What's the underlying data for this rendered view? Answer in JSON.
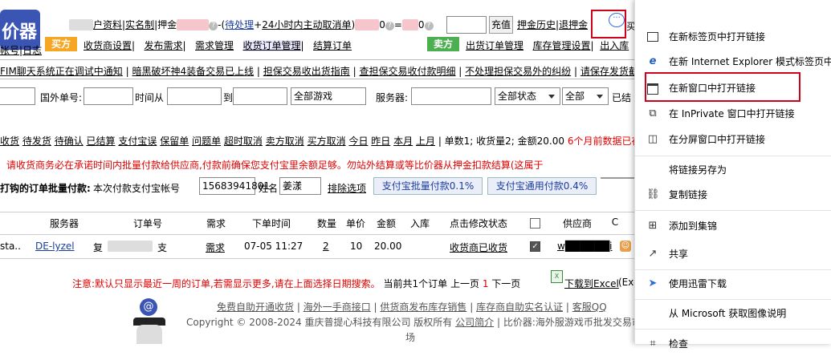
{
  "top": {
    "account_masked": "██████",
    "profile_link": "户资料",
    "realname_link": "实名制",
    "deposit_label": "押金",
    "deposit_value": "████",
    "pending_link": "待处理",
    "plus_text": "+",
    "cancel24_link": "24小时内主动取消单",
    "paren_close": ")",
    "zero1": "0",
    "eq": "=",
    "zero2": "0",
    "charge_button": "充值",
    "deposit_history": "押金历史",
    "withdraw_deposit": "退押金",
    "partial_text": "买"
  },
  "nav": {
    "logo_text": "价器",
    "buyer_tag": "买方",
    "buyer_links": [
      "收货商设置",
      "发布需求",
      "需求管理",
      "收货订单管理",
      "结算订单"
    ],
    "seller_tag": "卖方",
    "seller_links": [
      "出货订单管理",
      "库存管理设置",
      "出入库"
    ],
    "left_links": [
      "帐号",
      "日志"
    ]
  },
  "notice_bar": [
    "FIM聊天系统正在调试中通知",
    "暗黑破坏神4装备交易已上线",
    "担保交易收出货指南",
    "查担保交易收付款明细",
    "不处理担保交易外的纠纷",
    "请保存发货截"
  ],
  "filters": {
    "foreign_order_label": "国外单号:",
    "time_from_label": "时间从",
    "to_label": "到",
    "game_select": "全部游戏",
    "server_label": "服务器:",
    "status_select": "全部状态",
    "all_select": "全部",
    "settled_label": "已结"
  },
  "status_tabs": [
    "收货",
    "待发货",
    "待确认",
    "已结算",
    "支付宝误",
    "保留单",
    "问题单",
    "超时取消",
    "卖方取消",
    "买方取消",
    "今日",
    "昨日",
    "本月",
    "上月"
  ],
  "summary": {
    "text": "单数1; 收货量2; 金额20.00",
    "warning": "6个月前数据已存"
  },
  "alert_text": "请收货商务必在承诺时间内批量付款给供应商,付款前确保您支付宝里余额足够。勿站外结算或等比价器从押金扣款结算(这属于",
  "batch_pay": {
    "label": "打钩的订单批量付款:",
    "account_label": "本次付款支付宝帐号",
    "account_value": "15683941801",
    "name_label": "姓名",
    "name_value": "姜漾",
    "sort_link": "排除选项",
    "alipay_batch": "支付宝批量付款0.1%",
    "alipay_general": "支付宝通用付款0.4%"
  },
  "table": {
    "headers": [
      "服务器",
      "订单号",
      "需求",
      "下单时间",
      "数量",
      "单价",
      "金额",
      "入库",
      "点击修改状态",
      "",
      "供应商"
    ],
    "rows": [
      {
        "game": "sta..",
        "server": "DE-lyzel",
        "order_prefix": "复",
        "order_no": "██████",
        "order_suffix": "支",
        "demand": "需求",
        "time": "07-05 11:27",
        "qty": "2",
        "price": "10",
        "amount": "20.00",
        "stock": "",
        "status": "收货商已收货",
        "supplier": "w██████i"
      }
    ]
  },
  "footer": {
    "note": "注意:默认只显示最近一周的订单,若需显示更多,请在上面选择日期搜索。",
    "count_text": "当前共1个订单",
    "prev": "上一页",
    "page": "1",
    "next": "下一页",
    "export": "下载到Excel",
    "export_suffix": "(Exc",
    "links": [
      "免费自助开通收货",
      "海外一手商接口",
      "供货商发布库存销售",
      "库存商自助实名认证",
      "客服QQ"
    ],
    "copyright": "Copyright © 2008-2024 重庆普提心科技有限公司 版权所有",
    "intro_link": "公司简介",
    "tail_text": "比价器:海外服游戏币批发交易市",
    "tail2": "场"
  },
  "context_menu": {
    "items": [
      {
        "label": "在新标签页中打开链接",
        "icon": "new-tab-icon"
      },
      {
        "label": "在新 Internet Explorer 模式标签页中打",
        "icon": "ie-icon"
      },
      {
        "label": "在新窗口中打开链接",
        "icon": "new-window-icon"
      },
      {
        "label": "在 InPrivate 窗口中打开链接",
        "icon": "inprivate-icon"
      },
      {
        "label": "在分屏窗口中打开链接",
        "icon": "split-screen-icon"
      },
      {
        "label": "将链接另存为",
        "icon": ""
      },
      {
        "label": "复制链接",
        "icon": "copy-link-icon"
      },
      {
        "label": "添加到集锦",
        "icon": "collections-icon"
      },
      {
        "label": "共享",
        "icon": "share-icon"
      },
      {
        "label": "使用迅雷下载",
        "icon": "xunlei-icon"
      },
      {
        "label": "从 Microsoft 获取图像说明",
        "icon": ""
      },
      {
        "label": "检查",
        "icon": "inspect-icon"
      }
    ]
  },
  "colors": {
    "accent_red": "#d0021b",
    "buyer_tag": "#f5a623",
    "seller_tag": "#4caf50",
    "link_blue": "#1a3c9e"
  }
}
